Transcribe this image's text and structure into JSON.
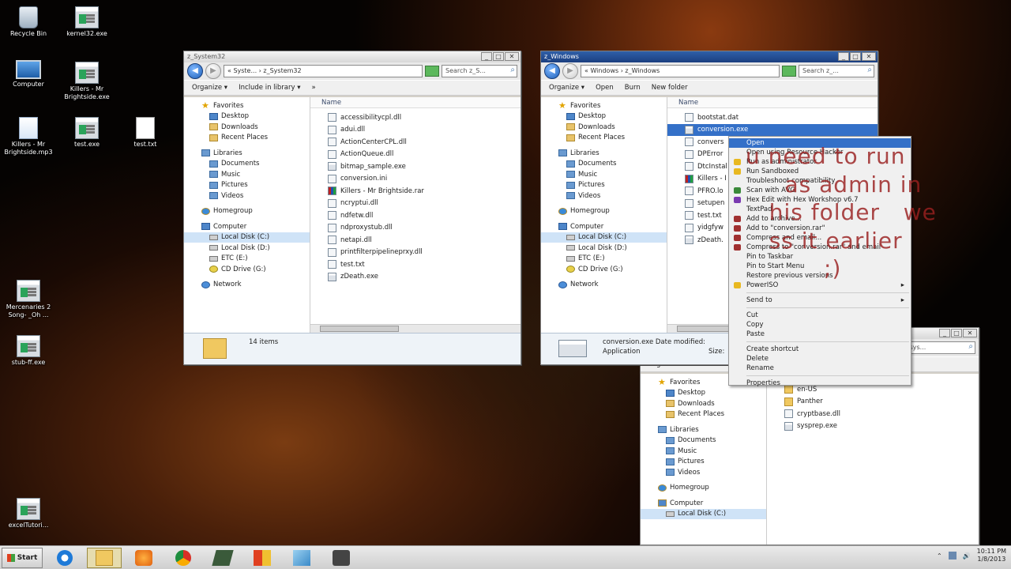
{
  "desktop_icons": [
    {
      "label": "Recycle Bin",
      "icon": "recycle-bin-icon"
    },
    {
      "label": "kernel32.exe",
      "icon": "exe-icon"
    },
    {
      "label": "Computer",
      "icon": "computer-icon"
    },
    {
      "label": "Killers - Mr Brightside.exe",
      "icon": "exe-icon"
    },
    {
      "label": "Killers - Mr Brightside.mp3",
      "icon": "mp3-icon"
    },
    {
      "label": "test.exe",
      "icon": "exe-icon"
    },
    {
      "label": "test.txt",
      "icon": "txt-icon"
    },
    {
      "label": "Mercenaries 2 Song- _Oh ...",
      "icon": "exe-icon"
    },
    {
      "label": "stub-ff.exe",
      "icon": "exe-icon"
    },
    {
      "label": "excelTutori...",
      "icon": "exe-icon"
    }
  ],
  "win1": {
    "title": "z_System32",
    "address": "« Syste... › z_System32",
    "search": "Search z_S...",
    "toolbar": [
      "Organize ▾",
      "Include in library ▾",
      "»"
    ],
    "col": "Name",
    "files": [
      "accessibilitycpl.dll",
      "adui.dll",
      "ActionCenterCPL.dll",
      "ActionQueue.dll",
      "bitmap_sample.exe",
      "conversion.ini",
      "Killers - Mr Brightside.rar",
      "ncryptui.dll",
      "ndfetw.dll",
      "ndproxystub.dll",
      "netapi.dll",
      "printfilterpipelineprxy.dll",
      "test.txt",
      "zDeath.exe"
    ],
    "status": "14 items"
  },
  "win2": {
    "title": "z_Windows",
    "address": "« Windows › z_Windows",
    "search": "Search z_...",
    "toolbar": [
      "Organize ▾",
      "Open",
      "Burn",
      "New folder"
    ],
    "col": "Name",
    "files": [
      "bootstat.dat",
      "conversion.exe",
      "convers",
      "DPError",
      "DtcInstal",
      "Killers - I",
      "PFRO.lo",
      "setupen",
      "test.txt",
      "yidgfyw",
      "zDeath."
    ],
    "detail_name": "conversion.exe  Date modified:",
    "detail_type": "Application",
    "detail_size": "Size:"
  },
  "win3": {
    "search": "h sys...",
    "toolbar": [
      "Organize ▾",
      "Sh"
    ],
    "files": [
      "en-US",
      "Panther",
      "cryptbase.dll",
      "sysprep.exe"
    ]
  },
  "sidebar": {
    "favorites": "Favorites",
    "desktop": "Desktop",
    "downloads": "Downloads",
    "recent": "Recent Places",
    "libraries": "Libraries",
    "documents": "Documents",
    "music": "Music",
    "pictures": "Pictures",
    "videos": "Videos",
    "homegroup": "Homegroup",
    "computer": "Computer",
    "local_c": "Local Disk (C:)",
    "local_d": "Local Disk (D:)",
    "etc": "ETC (E:)",
    "cd": "CD Drive (G:)",
    "network": "Network"
  },
  "context_menu": [
    {
      "label": "Open",
      "hi": true
    },
    {
      "label": "Open using Resource Hacker"
    },
    {
      "label": "Run as administrator"
    },
    {
      "label": "Run Sandboxed"
    },
    {
      "label": "Troubleshoot compatibility"
    },
    {
      "label": "Scan with AVG"
    },
    {
      "label": "Hex Edit with Hex Workshop v6.7"
    },
    {
      "label": "TextPad"
    },
    {
      "label": "Add to archive..."
    },
    {
      "label": "Add to \"conversion.rar\""
    },
    {
      "label": "Compress and email..."
    },
    {
      "label": "Compress to \"conversion.rar\" and email"
    },
    {
      "label": "Pin to Taskbar"
    },
    {
      "label": "Pin to Start Menu"
    },
    {
      "label": "Restore previous versions"
    },
    {
      "label": "PowerISO",
      "sub": true
    },
    {
      "sep": true
    },
    {
      "label": "Send to",
      "sub": true
    },
    {
      "sep": true
    },
    {
      "label": "Cut"
    },
    {
      "label": "Copy"
    },
    {
      "label": "Paste"
    },
    {
      "sep": true
    },
    {
      "label": "Create shortcut"
    },
    {
      "label": "Delete"
    },
    {
      "label": "Rename"
    },
    {
      "sep": true
    },
    {
      "label": "Properties"
    }
  ],
  "overlay_text": "u need to run\n     as admin in\n   his folder   we\n   ss it earlier\n          ;)",
  "taskbar": {
    "start": "Start",
    "time": "10:11 PM",
    "date": "1/8/2013"
  }
}
